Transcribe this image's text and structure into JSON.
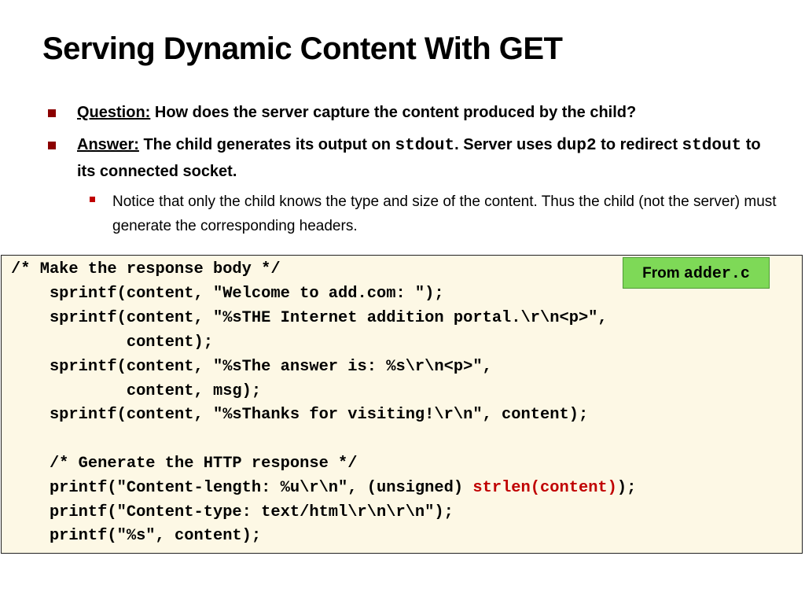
{
  "title": "Serving Dynamic Content With GET",
  "bullets": [
    {
      "lead": "Question:",
      "text": " How does the server capture the content produced by the child?"
    },
    {
      "lead": "Answer:",
      "t1": " The child generates its output on ",
      "c1": "stdout",
      "t2": ".  Server uses ",
      "c2": "dup2",
      "t3": "  to redirect ",
      "c3": "stdout",
      "t4": "  to its connected socket."
    }
  ],
  "sub_bullet": "Notice that only the child knows the type and size of the content. Thus the child (not the server) must generate the corresponding headers.",
  "code": {
    "lines": [
      "/* Make the response body */",
      "    sprintf(content, \"Welcome to add.com: \");",
      "    sprintf(content, \"%sTHE Internet addition portal.\\r\\n<p>\",",
      "            content);",
      "    sprintf(content, \"%sThe answer is: %s\\r\\n<p>\",",
      "            content, msg);",
      "    sprintf(content, \"%sThanks for visiting!\\r\\n\", content);",
      "",
      "    /* Generate the HTTP response */",
      "    printf(\"Content-length: %u\\r\\n\", (unsigned) ",
      "    printf(\"Content-type: text/html\\r\\n\\r\\n\");",
      "    printf(\"%s\", content);"
    ],
    "highlight": "strlen(content)",
    "after_highlight": ");"
  },
  "badge": {
    "label": "From ",
    "file": "adder.c"
  },
  "colors": {
    "bullet_marker": "#8b0000",
    "highlight": "#c00000",
    "code_bg": "#fdf8e5",
    "badge_bg": "#7ed957"
  }
}
